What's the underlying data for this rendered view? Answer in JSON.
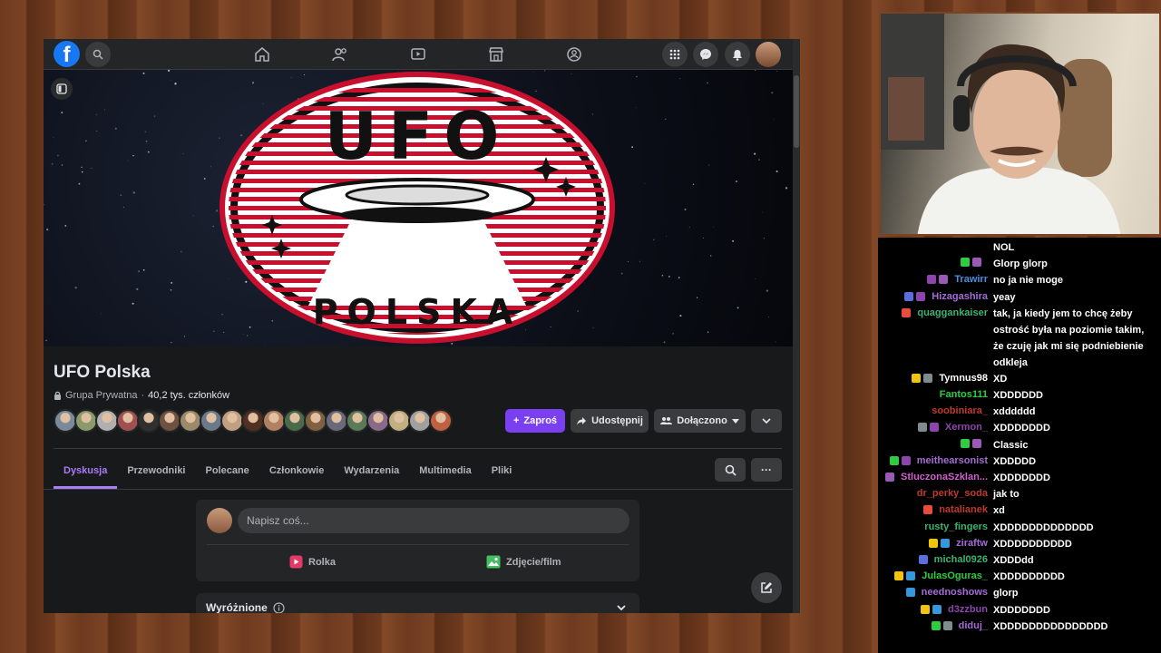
{
  "fb": {
    "logo": "f",
    "group": {
      "title": "UFO Polska",
      "meta_type": "Grupa Prywatna",
      "meta_sep": " · ",
      "meta_members": "40,2 tys. członków"
    },
    "cover_logo": {
      "top": "UFO",
      "bottom": "POLSKA"
    },
    "buttons": {
      "invite": "Zaproś",
      "share": "Udostępnij",
      "joined": "Dołączono"
    },
    "tabs": [
      "Dyskusja",
      "Przewodniki",
      "Polecane",
      "Członkowie",
      "Wydarzenia",
      "Multimedia",
      "Pliki"
    ],
    "more_glyph": "···",
    "composer": {
      "placeholder": "Napisz coś...",
      "reel": "Rolka",
      "photo": "Zdjęcie/film"
    },
    "featured": "Wyróżnione",
    "colors": {
      "accent": "#7b3ff2",
      "fb_blue": "#1877f2",
      "surface": "#242526",
      "bg": "#18191a"
    }
  },
  "chat": [
    {
      "name": "",
      "color": "#fff",
      "badges": [],
      "msg": "NOL"
    },
    {
      "name": "",
      "color": "#fff",
      "badges": [
        "#2ecc40",
        "#9b59b6"
      ],
      "msg": "Glorp glorp"
    },
    {
      "name": "Trawirr",
      "color": "#4a90e2",
      "badges": [
        "#8e44ad",
        "#9b59b6"
      ],
      "msg": "no ja nie moge"
    },
    {
      "name": "Hizagashira",
      "color": "#a46bd6",
      "badges": [
        "#5b6ee1",
        "#8e44ad"
      ],
      "msg": "yeay"
    },
    {
      "name": "quaggankaiser",
      "color": "#3cb371",
      "badges": [
        "#e74c3c"
      ],
      "msg": "tak, ja kiedy jem to chcę żeby ostrość była na poziomie takim, że czuję jak mi się podniebienie odkleja"
    },
    {
      "name": "Tymnus98",
      "color": "#fff",
      "badges": [
        "#f1c40f",
        "#7f8c8d"
      ],
      "msg": "XD"
    },
    {
      "name": "Fantos111",
      "color": "#2ecc40",
      "badges": [],
      "msg": "XDDDDDD"
    },
    {
      "name": "soobiniara_",
      "color": "#c0392b",
      "badges": [],
      "msg": "xdddddd"
    },
    {
      "name": "Xermon_",
      "color": "#8e44ad",
      "badges": [
        "#7f8c8d",
        "#8e44ad"
      ],
      "msg": "XDDDDDDD"
    },
    {
      "name": "",
      "color": "#fff",
      "badges": [
        "#2ecc40",
        "#9b59b6"
      ],
      "msg": "Classic"
    },
    {
      "name": "meithearsonist",
      "color": "#a46bd6",
      "badges": [
        "#2ecc40",
        "#8e44ad"
      ],
      "msg": "XDDDDD"
    },
    {
      "name": "StluczonaSzklan...",
      "color": "#d060d0",
      "badges": [
        "#9b59b6"
      ],
      "msg": "XDDDDDDD"
    },
    {
      "name": "dr_perky_soda",
      "color": "#c0392b",
      "badges": [],
      "msg": "jak to"
    },
    {
      "name": "natalianek",
      "color": "#c0392b",
      "badges": [
        "#e74c3c"
      ],
      "msg": "xd"
    },
    {
      "name": "rusty_fingers",
      "color": "#3cb371",
      "badges": [],
      "msg": "XDDDDDDDDDDDDD"
    },
    {
      "name": "ziraftw",
      "color": "#a46bd6",
      "badges": [
        "#f1c40f",
        "#3498db"
      ],
      "msg": "XDDDDDDDDDD"
    },
    {
      "name": "michal0926",
      "color": "#3cb371",
      "badges": [
        "#5b6ee1"
      ],
      "msg": "XDDDdd"
    },
    {
      "name": "JulasOguras_",
      "color": "#2ecc40",
      "badges": [
        "#f1c40f",
        "#3498db"
      ],
      "msg": "XDDDDDDDDD"
    },
    {
      "name": "neednoshows",
      "color": "#a46bd6",
      "badges": [
        "#3498db"
      ],
      "msg": "glorp"
    },
    {
      "name": "d3zzbun",
      "color": "#8e44ad",
      "badges": [
        "#f1c40f",
        "#3498db"
      ],
      "msg": "XDDDDDDD"
    },
    {
      "name": "diduj_",
      "color": "#a46bd6",
      "badges": [
        "#2ecc40",
        "#7f8c8d"
      ],
      "msg": "XDDDDDDDDDDDDDDD"
    }
  ]
}
